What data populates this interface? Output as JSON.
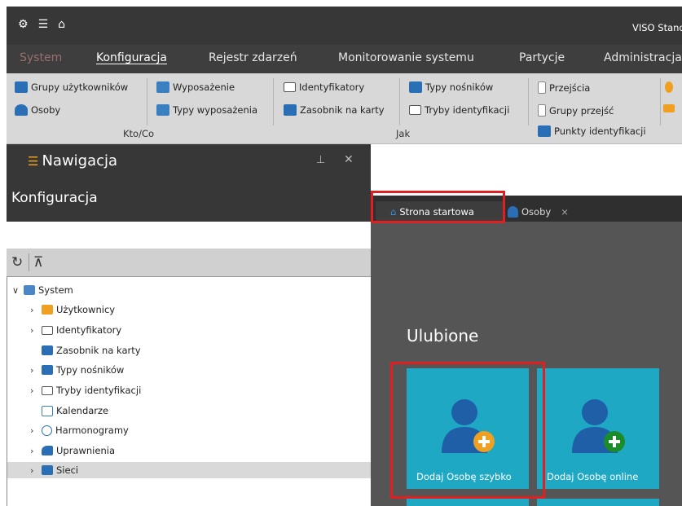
{
  "app": {
    "title": "VISO Standa"
  },
  "menu": {
    "items": [
      "System",
      "Konfiguracja",
      "Rejestr zdarzeń",
      "Monitorowanie systemu",
      "Partycje",
      "Administracja"
    ]
  },
  "ribbon": {
    "grupy_uzytkownikow": "Grupy użytkowników",
    "osoby": "Osoby",
    "wyposazenie": "Wyposażenie",
    "typy_wyposazenia": "Typy wyposażenia",
    "identyfikatory": "Identyfikatory",
    "zasobnik_na_karty": "Zasobnik na karty",
    "typy_nosnikow": "Typy nośników",
    "tryby_identyfikacji": "Tryby identyfikacji",
    "przejscia": "Przejścia",
    "grupy_przejsc": "Grupy przejść",
    "punkty_identyfikacji": "Punkty identyfikacji",
    "group_kto_co": "Kto/Co",
    "group_jak": "Jak"
  },
  "navigation": {
    "title": "Nawigacja",
    "section": "Konfiguracja",
    "tree": [
      {
        "label": "System",
        "expanded": true
      },
      {
        "label": "Użytkownicy"
      },
      {
        "label": "Identyfikatory"
      },
      {
        "label": "Zasobnik na karty"
      },
      {
        "label": "Typy nośników"
      },
      {
        "label": "Tryby identyfikacji"
      },
      {
        "label": "Kalendarze"
      },
      {
        "label": "Harmonogramy"
      },
      {
        "label": "Uprawnienia"
      },
      {
        "label": "Sieci",
        "selected": true
      }
    ]
  },
  "tabs": [
    {
      "label": "Strona startowa",
      "active": true
    },
    {
      "label": "Osoby",
      "active": false
    }
  ],
  "start_page": {
    "favorites_title": "Ulubione",
    "tiles": [
      "Dodaj Osobę szybko",
      "Dodaj Osobę online"
    ]
  },
  "colors": {
    "tile": "#1fa8c4",
    "highlight": "#e02020",
    "dark": "#373737"
  }
}
